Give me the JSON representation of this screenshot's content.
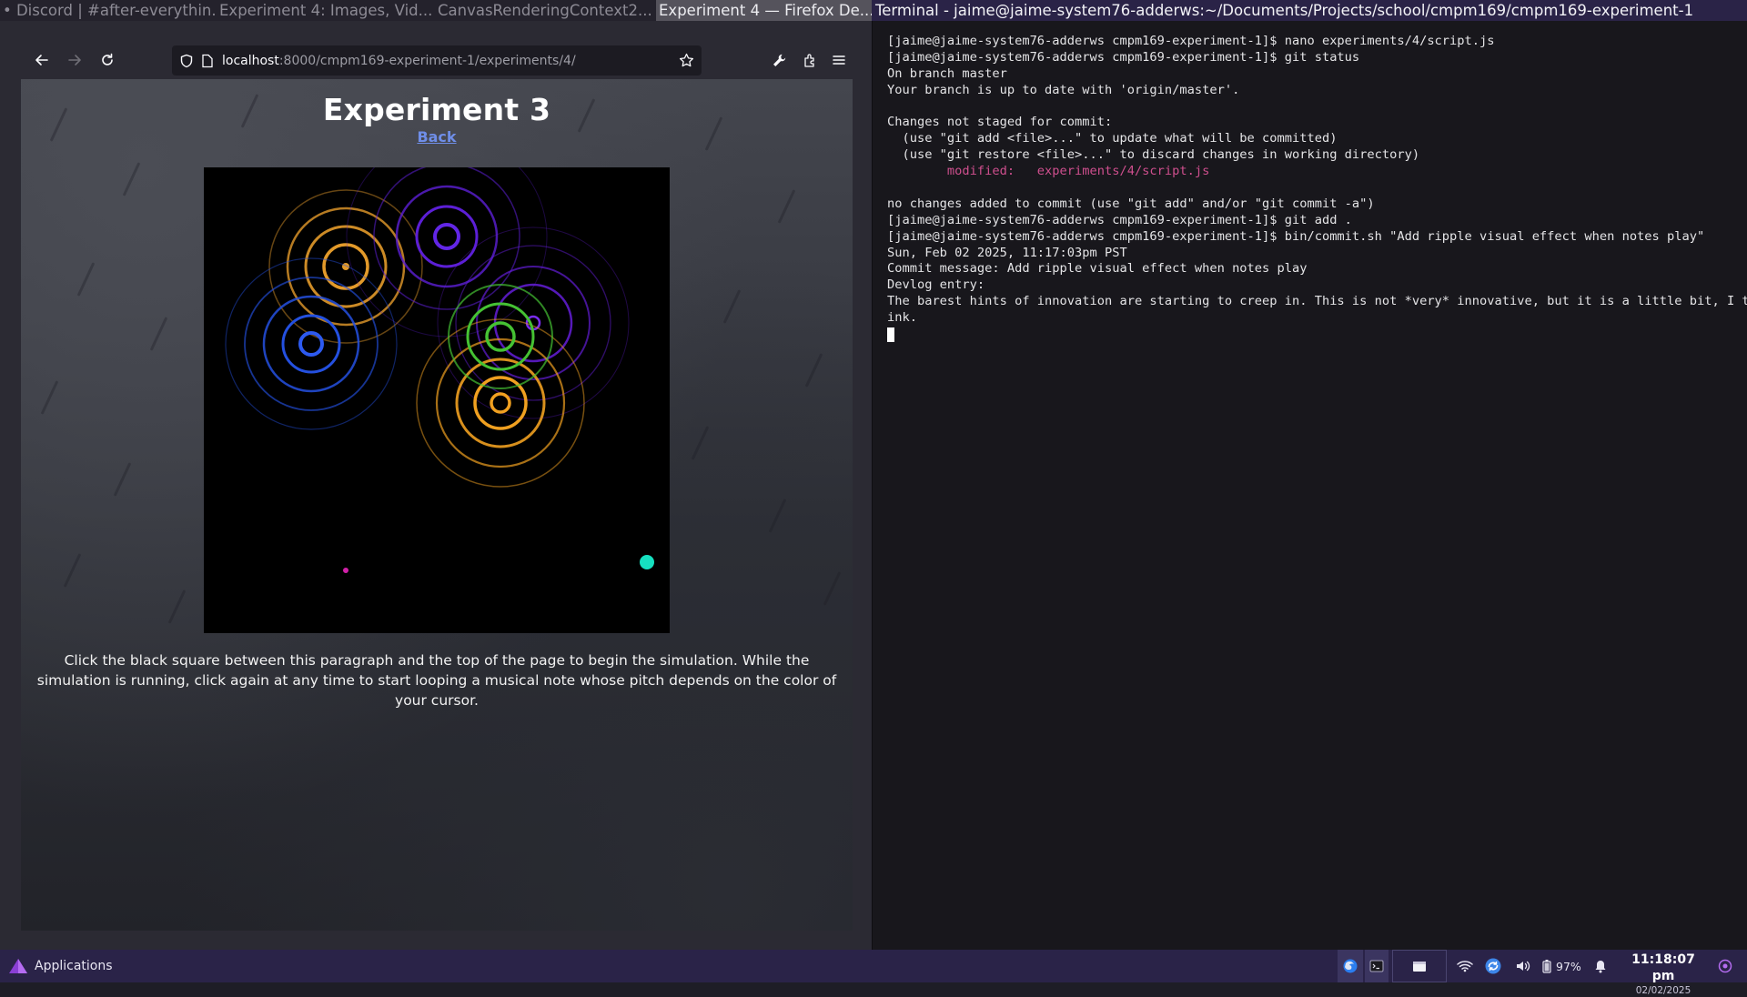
{
  "window_tabs": [
    {
      "label": "• Discord | #after-everythin...",
      "active": false
    },
    {
      "label": "Experiment 4: Images, Vid...",
      "active": false
    },
    {
      "label": "CanvasRenderingContext2...",
      "active": false
    },
    {
      "label": "Experiment 4 — Firefox De...",
      "active": true
    },
    {
      "label": "Terminal - jaime@jaime-system76-adderws:~/Documents/Projects/school/cmpm169/cmpm169-experiment-1",
      "active": true
    }
  ],
  "browser": {
    "url_host": "localhost",
    "url_rest": ":8000/cmpm169-experiment-1/experiments/4/",
    "icons": {
      "back": "arrow-left-icon",
      "forward": "arrow-right-icon",
      "reload": "reload-icon",
      "shield": "shield-icon",
      "page": "page-icon",
      "bookmark": "star-icon",
      "devtools": "wrench-icon",
      "extensions": "extensions-icon",
      "menu": "hamburger-menu-icon"
    }
  },
  "page": {
    "title": "Experiment 3",
    "back_link": "Back",
    "instructions": "Click the black square between this paragraph and the top of the page to begin the simulation. While the simulation is running, click again at any time to start looping a musical note whose pitch depends on the color of your cursor."
  },
  "canvas_scene": {
    "background": "#000000",
    "ripples": [
      {
        "color": "#e39a2a",
        "rings": 4
      },
      {
        "color": "#5c1fd6",
        "rings": 4
      },
      {
        "color": "#2450e0",
        "rings": 4
      },
      {
        "color": "#6a1fe6",
        "rings": 4
      },
      {
        "color": "#45c233",
        "rings": 3
      },
      {
        "color": "#f0a020",
        "rings": 4
      }
    ],
    "dots": [
      {
        "color": "#d020a8"
      },
      {
        "color": "#16e0c0"
      }
    ]
  },
  "terminal": {
    "lines": [
      {
        "text": "[jaime@jaime-system76-adderws cmpm169-experiment-1]$ nano experiments/4/script.js",
        "style": "normal"
      },
      {
        "text": "[jaime@jaime-system76-adderws cmpm169-experiment-1]$ git status",
        "style": "normal"
      },
      {
        "text": "On branch master",
        "style": "normal"
      },
      {
        "text": "Your branch is up to date with 'origin/master'.",
        "style": "normal"
      },
      {
        "text": "",
        "style": "normal"
      },
      {
        "text": "Changes not staged for commit:",
        "style": "normal"
      },
      {
        "text": "  (use \"git add <file>...\" to update what will be committed)",
        "style": "normal"
      },
      {
        "text": "  (use \"git restore <file>...\" to discard changes in working directory)",
        "style": "normal"
      },
      {
        "text": "        modified:   experiments/4/script.js",
        "style": "modified"
      },
      {
        "text": "",
        "style": "normal"
      },
      {
        "text": "no changes added to commit (use \"git add\" and/or \"git commit -a\")",
        "style": "normal"
      },
      {
        "text": "[jaime@jaime-system76-adderws cmpm169-experiment-1]$ git add .",
        "style": "normal"
      },
      {
        "text": "[jaime@jaime-system76-adderws cmpm169-experiment-1]$ bin/commit.sh \"Add ripple visual effect when notes play\"",
        "style": "normal"
      },
      {
        "text": "Sun, Feb 02 2025, 11:17:03pm PST",
        "style": "normal"
      },
      {
        "text": "Commit message: Add ripple visual effect when notes play",
        "style": "normal"
      },
      {
        "text": "Devlog entry:",
        "style": "normal"
      },
      {
        "text": "The barest hints of innovation are starting to creep in. This is not *very* innovative, but it is a little bit, I th",
        "style": "normal"
      },
      {
        "text": "ink.",
        "style": "normal"
      }
    ]
  },
  "panel": {
    "applications_label": "Applications",
    "battery": "97%",
    "time": "11:18:07 pm",
    "date": "02/02/2025",
    "icons": [
      "firefox-icon",
      "terminal-icon",
      "file-manager-icon",
      "wifi-icon",
      "sync-icon",
      "volume-icon",
      "battery-icon",
      "notification-icon",
      "power-icon"
    ]
  },
  "colors": {
    "panel_bg": "#2a2348",
    "terminal_bg": "#18171c",
    "link": "#6f8ee8",
    "modified": "#cf4f8e"
  }
}
